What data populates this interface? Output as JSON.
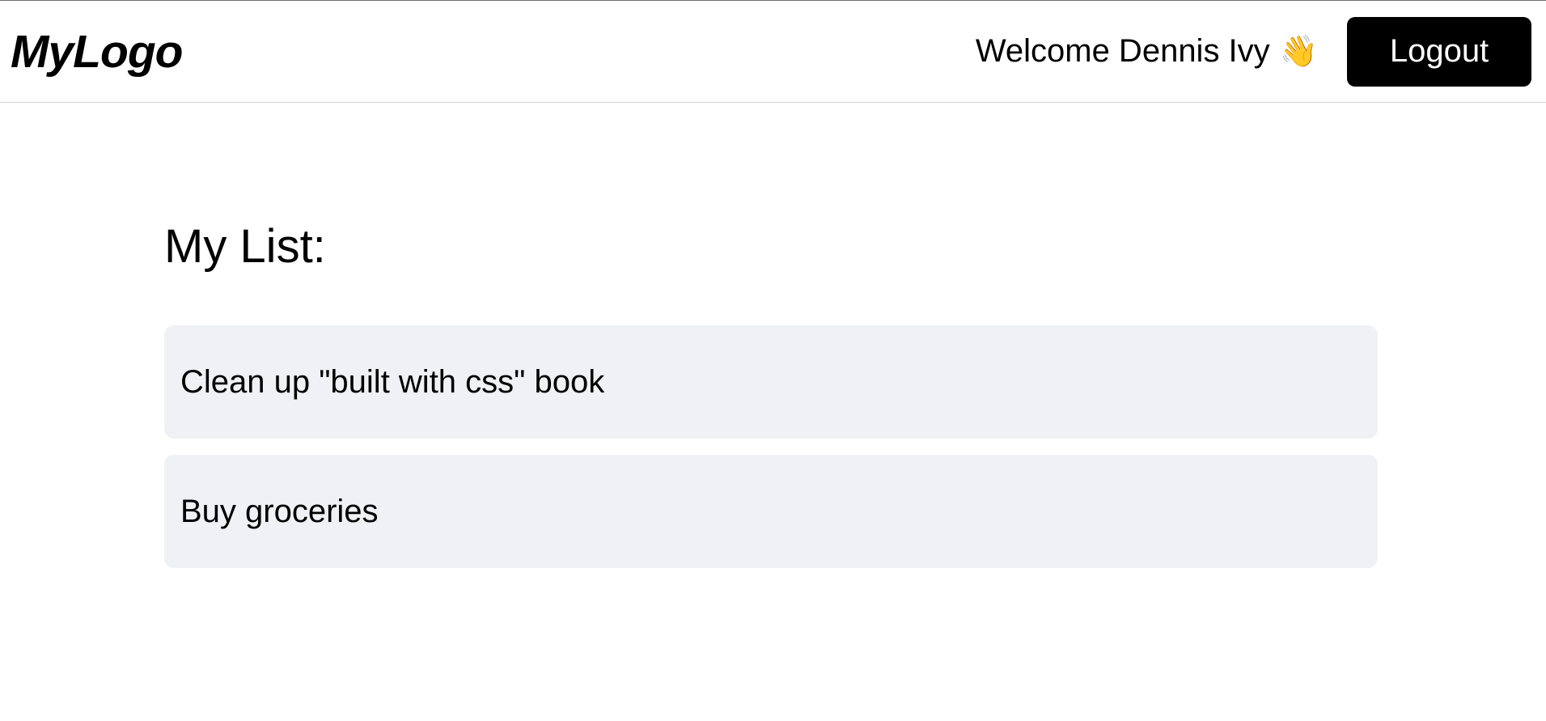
{
  "header": {
    "logo_text": "MyLogo",
    "welcome_text": "Welcome Dennis Ivy",
    "wave_emoji": "👋",
    "logout_label": "Logout"
  },
  "main": {
    "title": "My List:",
    "tasks": [
      {
        "title": "Clean up \"built with css\" book"
      },
      {
        "title": "Buy groceries"
      }
    ]
  },
  "colors": {
    "background": "#ffffff",
    "logout_button_bg": "#000000",
    "logout_button_text": "#ffffff",
    "task_bg": "#f0f1f5",
    "navbar_border": "#d4d4d4"
  }
}
